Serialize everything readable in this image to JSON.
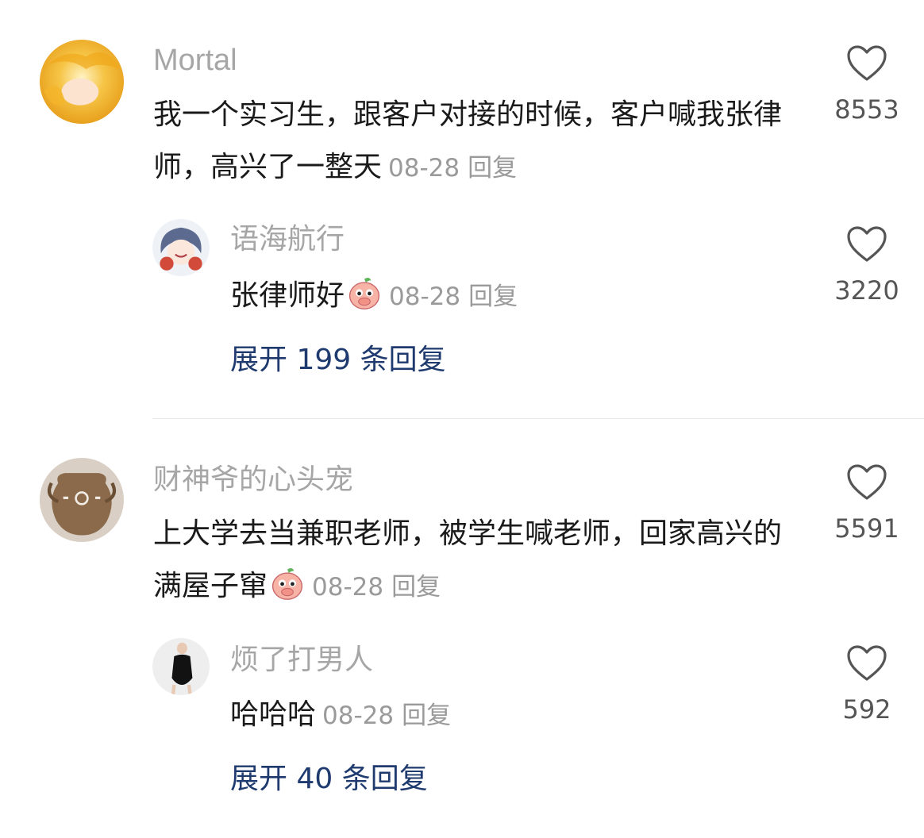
{
  "comments": [
    {
      "username": "Mortal",
      "text": "我一个实习生，跟客户对接的时候，客户喊我张律师，高兴了一整天",
      "date": "08-28",
      "reply_label": "回复",
      "likes": "8553",
      "avatar_icon": "golden-hair-portrait",
      "reply": {
        "username": "语海航行",
        "text": "张律师好",
        "emoji": "peach-covering-mouth-emoji",
        "date": "08-28",
        "reply_label": "回复",
        "likes": "3220",
        "avatar_icon": "anime-girl-portrait"
      },
      "expand_label": "展开 199 条回复"
    },
    {
      "username": "财神爷的心头宠",
      "text": "上大学去当兼职老师，被学生喊老师，回家高兴的满屋子窜",
      "emoji": "peach-covering-mouth-emoji",
      "date": "08-28",
      "reply_label": "回复",
      "likes": "5591",
      "avatar_icon": "clay-pot-photo",
      "reply": {
        "username": "烦了打男人",
        "text": "哈哈哈",
        "date": "08-28",
        "reply_label": "回复",
        "likes": "592",
        "avatar_icon": "woman-black-dress-photo"
      },
      "expand_label": "展开 40 条回复"
    }
  ],
  "colors": {
    "username": "#a6a6a6",
    "text": "#1a1a1a",
    "meta": "#9a9a9a",
    "expand_link": "#1e3a6e",
    "heart_outline": "#555555"
  }
}
